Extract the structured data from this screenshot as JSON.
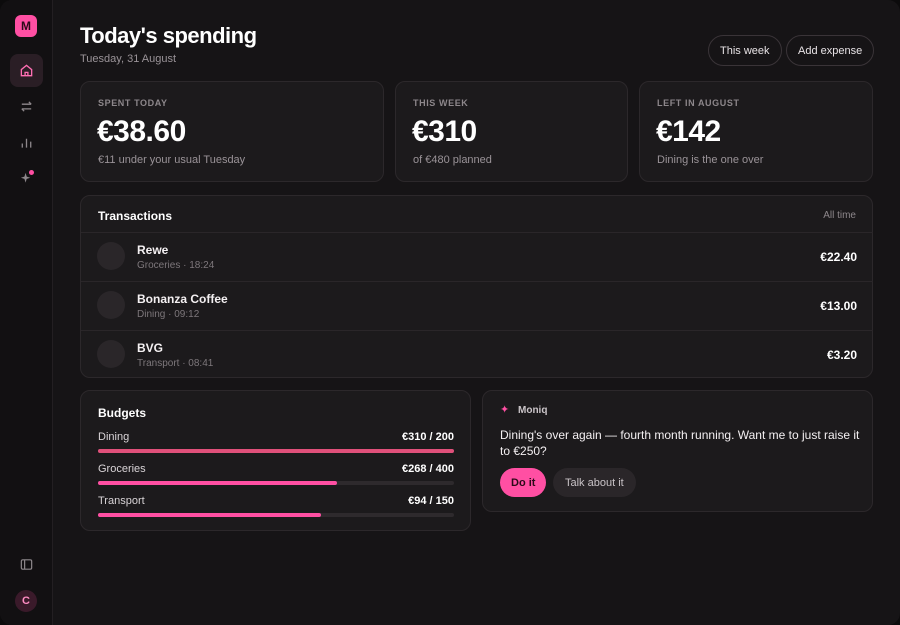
{
  "sidebar": {
    "logo": "M",
    "nav": [
      {
        "icon": "home-icon",
        "active": true
      },
      {
        "icon": "transfer-icon"
      },
      {
        "icon": "chart-icon"
      },
      {
        "icon": "sparkle-icon",
        "badge": true
      }
    ],
    "bottom_icon": "panel-icon",
    "avatar": "C"
  },
  "header": {
    "title": "Today's spending",
    "date": "Tuesday, 31 August",
    "range_button": "This week",
    "add_button": "Add expense"
  },
  "stats": [
    {
      "label": "SPENT TODAY",
      "value": "€38.60",
      "note": "€11 under your usual Tuesday"
    },
    {
      "label": "THIS WEEK",
      "value": "€310",
      "note": "of €480 planned"
    },
    {
      "label": "LEFT IN AUGUST",
      "value": "€142",
      "note": "Dining is the one over"
    }
  ],
  "transactions": {
    "title": "Transactions",
    "filter": "All time",
    "rows": [
      {
        "name": "Rewe",
        "meta": "Groceries · 18:24",
        "amount": "€22.40"
      },
      {
        "name": "Bonanza Coffee",
        "meta": "Dining · 09:12",
        "amount": "€13.00"
      },
      {
        "name": "BVG",
        "meta": "Transport · 08:41",
        "amount": "€3.20"
      }
    ]
  },
  "budgets": {
    "title": "Budgets",
    "items": [
      {
        "name": "Dining",
        "value": "€310 / 200",
        "spent": 310,
        "limit": 200,
        "color": "#e0507a"
      },
      {
        "name": "Groceries",
        "value": "€268 / 400",
        "spent": 268,
        "limit": 400,
        "color": "#ff4fa3"
      },
      {
        "name": "Transport",
        "value": "€94 / 150",
        "spent": 94,
        "limit": 150,
        "color": "#ff4fa3"
      }
    ]
  },
  "assistant": {
    "name": "Moniq",
    "message": "Dining's over again — fourth month running. Want me to just raise it to €250?",
    "primary": "Do it",
    "secondary": "Talk about it"
  },
  "colors": {
    "accent": "#ff4fa3",
    "over": "#e0507a"
  }
}
